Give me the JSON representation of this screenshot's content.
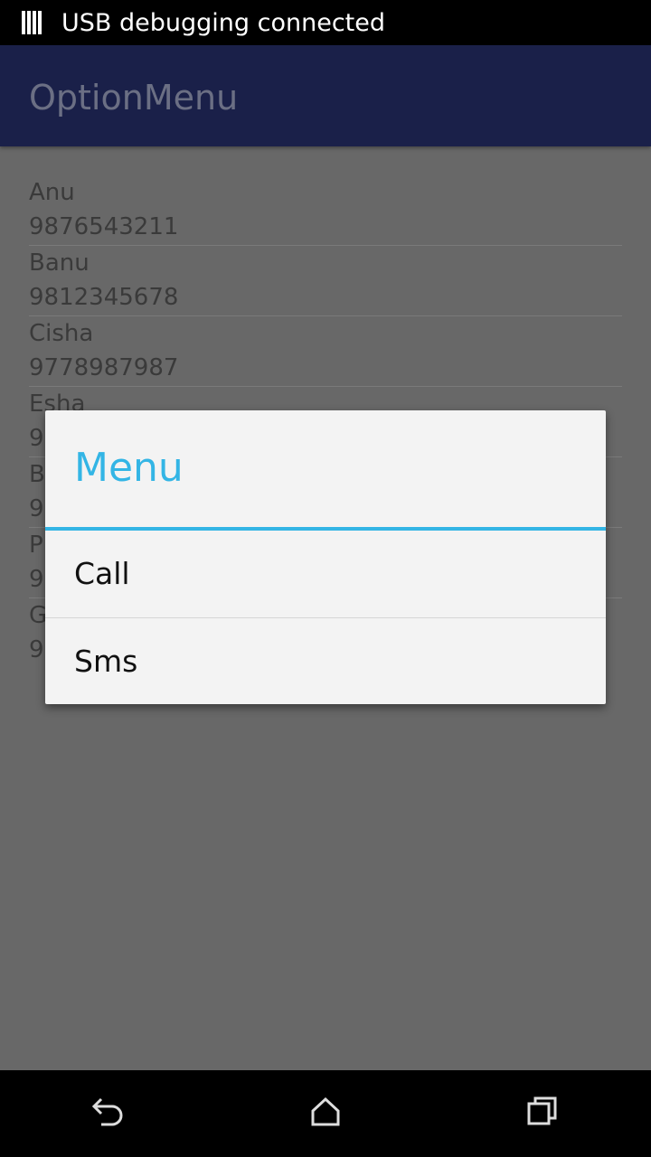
{
  "status_bar": {
    "icon": "usb-debug-icon",
    "text": "USB debugging connected"
  },
  "app_bar": {
    "title": "OptionMenu"
  },
  "contacts": [
    {
      "name": "Anu",
      "phone": "9876543211"
    },
    {
      "name": "Banu",
      "phone": "9812345678"
    },
    {
      "name": "Cisha",
      "phone": "9778987987"
    },
    {
      "name": "Esha",
      "phone": "9"
    },
    {
      "name": "B",
      "phone": "9"
    },
    {
      "name": "P",
      "phone": "9"
    },
    {
      "name": "G",
      "phone": "9"
    }
  ],
  "dialog": {
    "title": "Menu",
    "items": [
      {
        "label": "Call"
      },
      {
        "label": "Sms"
      }
    ]
  },
  "nav_bar": {
    "back": "back-icon",
    "home": "home-icon",
    "recents": "recents-icon"
  },
  "colors": {
    "accent": "#33b5e5",
    "app_bar": "#1a2049",
    "dim_background": "#686868"
  }
}
